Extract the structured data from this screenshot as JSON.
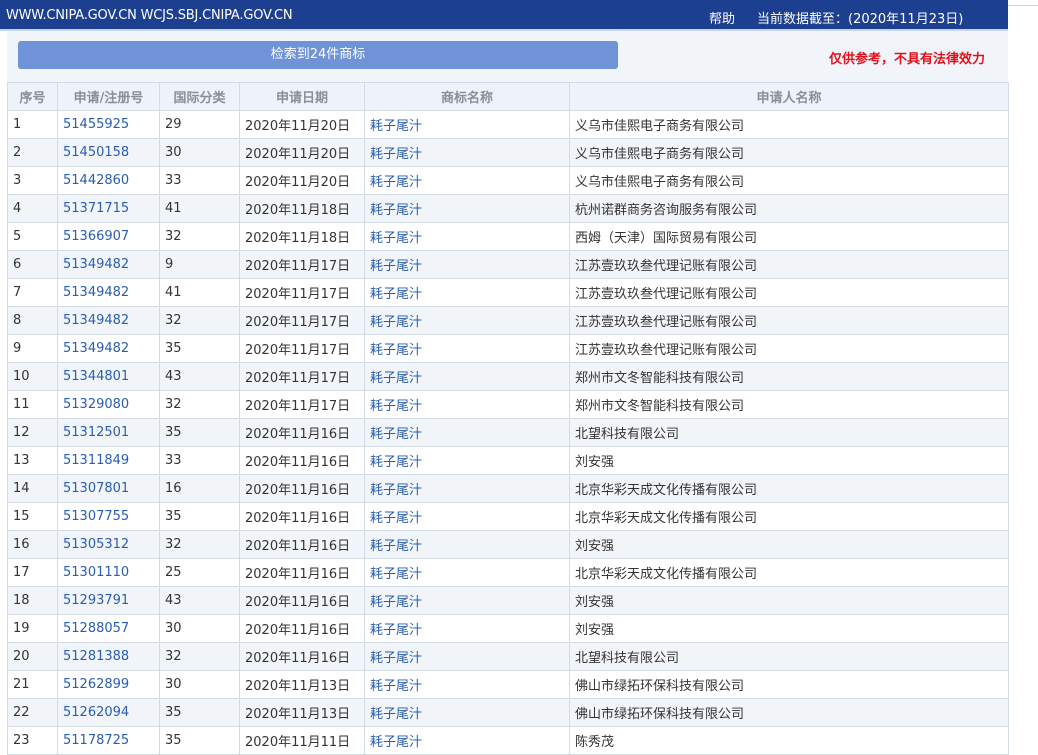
{
  "header": {
    "sites": "WWW.CNIPA.GOV.CN WCJS.SBJ.CNIPA.GOV.CN",
    "help": "帮助",
    "data_as_of": "当前数据截至：(2020年11月23日)"
  },
  "search": {
    "result_count": "检索到24件商标",
    "disclaimer": "仅供参考，不具有法律效力"
  },
  "table": {
    "columns": [
      "序号",
      "申请/注册号",
      "国际分类",
      "申请日期",
      "商标名称",
      "申请人名称"
    ],
    "rows": [
      {
        "no": "1",
        "reg": "51455925",
        "cls": "29",
        "date": "2020年11月20日",
        "name": "耗子尾汁",
        "applicant": "义乌市佳熙电子商务有限公司"
      },
      {
        "no": "2",
        "reg": "51450158",
        "cls": "30",
        "date": "2020年11月20日",
        "name": "耗子尾汁",
        "applicant": "义乌市佳熙电子商务有限公司"
      },
      {
        "no": "3",
        "reg": "51442860",
        "cls": "33",
        "date": "2020年11月20日",
        "name": "耗子尾汁",
        "applicant": "义乌市佳熙电子商务有限公司"
      },
      {
        "no": "4",
        "reg": "51371715",
        "cls": "41",
        "date": "2020年11月18日",
        "name": "耗子尾汁",
        "applicant": "杭州诺群商务咨询服务有限公司"
      },
      {
        "no": "5",
        "reg": "51366907",
        "cls": "32",
        "date": "2020年11月18日",
        "name": "耗子尾汁",
        "applicant": "西姆（天津）国际贸易有限公司"
      },
      {
        "no": "6",
        "reg": "51349482",
        "cls": "9",
        "date": "2020年11月17日",
        "name": "耗子尾汁",
        "applicant": "江苏壹玖玖叁代理记账有限公司"
      },
      {
        "no": "7",
        "reg": "51349482",
        "cls": "41",
        "date": "2020年11月17日",
        "name": "耗子尾汁",
        "applicant": "江苏壹玖玖叁代理记账有限公司"
      },
      {
        "no": "8",
        "reg": "51349482",
        "cls": "32",
        "date": "2020年11月17日",
        "name": "耗子尾汁",
        "applicant": "江苏壹玖玖叁代理记账有限公司"
      },
      {
        "no": "9",
        "reg": "51349482",
        "cls": "35",
        "date": "2020年11月17日",
        "name": "耗子尾汁",
        "applicant": "江苏壹玖玖叁代理记账有限公司"
      },
      {
        "no": "10",
        "reg": "51344801",
        "cls": "43",
        "date": "2020年11月17日",
        "name": "耗子尾汁",
        "applicant": "郑州市文冬智能科技有限公司"
      },
      {
        "no": "11",
        "reg": "51329080",
        "cls": "32",
        "date": "2020年11月17日",
        "name": "耗子尾汁",
        "applicant": "郑州市文冬智能科技有限公司"
      },
      {
        "no": "12",
        "reg": "51312501",
        "cls": "35",
        "date": "2020年11月16日",
        "name": "耗子尾汁",
        "applicant": "北望科技有限公司"
      },
      {
        "no": "13",
        "reg": "51311849",
        "cls": "33",
        "date": "2020年11月16日",
        "name": "耗子尾汁",
        "applicant": "刘安强"
      },
      {
        "no": "14",
        "reg": "51307801",
        "cls": "16",
        "date": "2020年11月16日",
        "name": "耗子尾汁",
        "applicant": "北京华彩天成文化传播有限公司"
      },
      {
        "no": "15",
        "reg": "51307755",
        "cls": "35",
        "date": "2020年11月16日",
        "name": "耗子尾汁",
        "applicant": "北京华彩天成文化传播有限公司"
      },
      {
        "no": "16",
        "reg": "51305312",
        "cls": "32",
        "date": "2020年11月16日",
        "name": "耗子尾汁",
        "applicant": "刘安强"
      },
      {
        "no": "17",
        "reg": "51301110",
        "cls": "25",
        "date": "2020年11月16日",
        "name": "耗子尾汁",
        "applicant": "北京华彩天成文化传播有限公司"
      },
      {
        "no": "18",
        "reg": "51293791",
        "cls": "43",
        "date": "2020年11月16日",
        "name": "耗子尾汁",
        "applicant": "刘安强"
      },
      {
        "no": "19",
        "reg": "51288057",
        "cls": "30",
        "date": "2020年11月16日",
        "name": "耗子尾汁",
        "applicant": "刘安强"
      },
      {
        "no": "20",
        "reg": "51281388",
        "cls": "32",
        "date": "2020年11月16日",
        "name": "耗子尾汁",
        "applicant": "北望科技有限公司"
      },
      {
        "no": "21",
        "reg": "51262899",
        "cls": "30",
        "date": "2020年11月13日",
        "name": "耗子尾汁",
        "applicant": "佛山市绿拓环保科技有限公司"
      },
      {
        "no": "22",
        "reg": "51262094",
        "cls": "35",
        "date": "2020年11月13日",
        "name": "耗子尾汁",
        "applicant": "佛山市绿拓环保科技有限公司"
      },
      {
        "no": "23",
        "reg": "51178725",
        "cls": "35",
        "date": "2020年11月11日",
        "name": "耗子尾汁",
        "applicant": "陈秀茂"
      }
    ]
  },
  "colors": {
    "header_bg": "#1d3f8f",
    "count_bar_bg": "#6f93d6",
    "disclaimer": "#e3101b",
    "link": "#2a5db0"
  }
}
